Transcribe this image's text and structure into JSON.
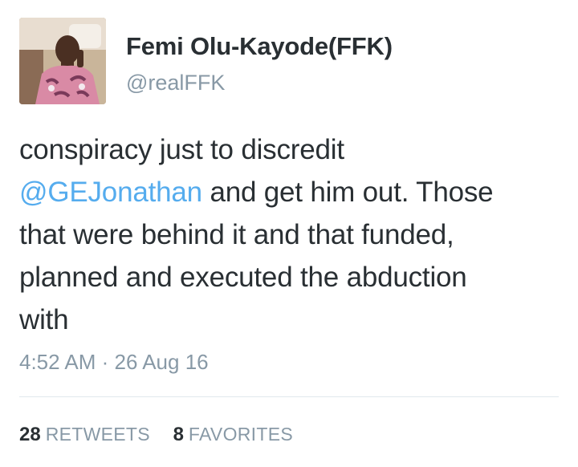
{
  "user": {
    "display_name": "Femi Olu-Kayode(FFK)",
    "handle": "@realFFK"
  },
  "tweet": {
    "line1": "conspiracy just to discredit",
    "mention": "@GEJonathan",
    "line2_rest": " and get him out. Those",
    "line3": "that were behind it and that funded,",
    "line4": "planned and executed the abduction",
    "line5": "with",
    "timestamp": "4:52 AM · 26 Aug 16"
  },
  "stats": {
    "retweets_count": "28",
    "retweets_label": "RETWEETS",
    "favorites_count": "8",
    "favorites_label": "FAVORITES"
  },
  "colors": {
    "text": "#292f33",
    "muted": "#8899a6",
    "link": "#55acee",
    "divider": "#e1e8ed"
  },
  "icons": {
    "avatar": "profile-photo"
  }
}
